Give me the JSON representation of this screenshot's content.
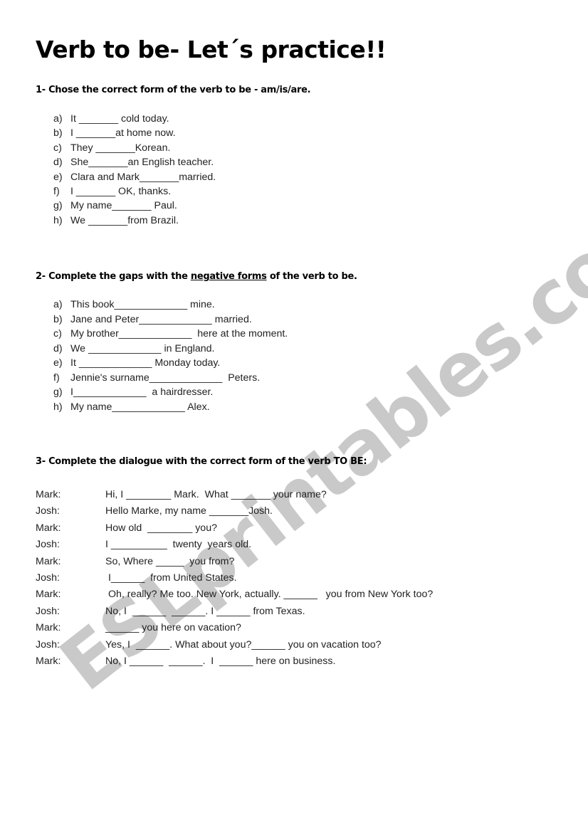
{
  "title": "Verb to be- Let´s practice!!",
  "section1": {
    "heading": "1- Chose the correct form of the verb to be - am/is/are.",
    "items": [
      {
        "label": "a)",
        "text": "It _______ cold today."
      },
      {
        "label": "b)",
        "text": "I _______at home now."
      },
      {
        "label": "c)",
        "text": "They _______Korean."
      },
      {
        "label": "d)",
        "text": "She_______an English teacher."
      },
      {
        "label": "e)",
        "text": "Clara and Mark_______married."
      },
      {
        "label": "f)",
        "text": "I _______ OK, thanks."
      },
      {
        "label": "g)",
        "text": "My name_______ Paul."
      },
      {
        "label": "h)",
        "text": "We _______from Brazil."
      }
    ]
  },
  "section2": {
    "heading_prefix": "2- Complete the gaps with the ",
    "heading_underlined": "negative forms",
    "heading_suffix": " of the verb to be.",
    "items": [
      {
        "label": "a)",
        "text": "This book_____________ mine."
      },
      {
        "label": "b)",
        "text": "Jane and Peter_____________ married."
      },
      {
        "label": "c)",
        "text": "My brother_____________  here at the moment."
      },
      {
        "label": "d)",
        "text": "We _____________ in England."
      },
      {
        "label": "e)",
        "text": "It _____________ Monday today."
      },
      {
        "label": "f)",
        "text": "Jennie's surname_____________  Peters."
      },
      {
        "label": "g)",
        "text": "I_____________  a hairdresser."
      },
      {
        "label": "h)",
        "text": "My name_____________ Alex."
      }
    ]
  },
  "section3": {
    "heading": "3- Complete the dialogue with the correct form of  the verb TO BE:",
    "lines": [
      {
        "speaker": "Mark:",
        "text": "Hi, I ________ Mark.  What _______ your name?"
      },
      {
        "speaker": "Josh:",
        "text": "Hello Marke, my name _______Josh."
      },
      {
        "speaker": "Mark:",
        "text": "How old  ________ you?"
      },
      {
        "speaker": "Josh:",
        "text": "I __________  twenty  years old."
      },
      {
        "speaker": "Mark:",
        "text": "So, Where _____  you from?"
      },
      {
        "speaker": "Josh:",
        "text": " I______  from United States."
      },
      {
        "speaker": "Mark:",
        "text": " Oh, really? Me too. New York, actually. ______   you from New York too?"
      },
      {
        "speaker": "Josh:",
        "text": "No, I  ______  ______. I ______ from Texas."
      },
      {
        "speaker": "Mark:",
        "text": "______ you here on vacation?"
      },
      {
        "speaker": "Josh:",
        "text": "Yes, I  ______. What about you?______ you on vacation too?"
      },
      {
        "speaker": "Mark:",
        "text": "No, I ______  ______.  I  ______ here on business."
      }
    ]
  },
  "watermark": {
    "text": "ESLprintables.com",
    "color": "#c9c9c9"
  }
}
